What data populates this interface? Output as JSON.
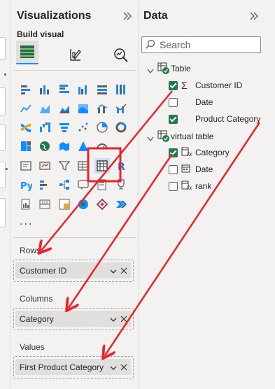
{
  "visualizations": {
    "title": "Visualizations",
    "build_visual_label": "Build visual",
    "more_label": "...",
    "wells": {
      "rows_label": "Rows",
      "rows_field": "Customer ID",
      "columns_label": "Columns",
      "columns_field": "Category",
      "values_label": "Values",
      "values_field": "First Product Category"
    }
  },
  "data": {
    "title": "Data",
    "search_placeholder": "Search",
    "tables": [
      {
        "name": "Table",
        "fields": [
          {
            "name": "Customer ID",
            "checked": true,
            "icon": "sigma-icon"
          },
          {
            "name": "Date",
            "checked": false,
            "icon": ""
          },
          {
            "name": "Product Category",
            "checked": true,
            "icon": ""
          }
        ]
      },
      {
        "name": "virtual table",
        "fields": [
          {
            "name": "Category",
            "checked": true,
            "icon": "calculated-column-icon"
          },
          {
            "name": "Date",
            "checked": false,
            "icon": "calendar-icon"
          },
          {
            "name": "rank",
            "checked": false,
            "icon": "calculated-column-icon"
          }
        ]
      }
    ]
  },
  "colors": {
    "annotation_red": "#e8242a",
    "accent_blue": "#118dff",
    "check_green": "#1f7a4d"
  }
}
